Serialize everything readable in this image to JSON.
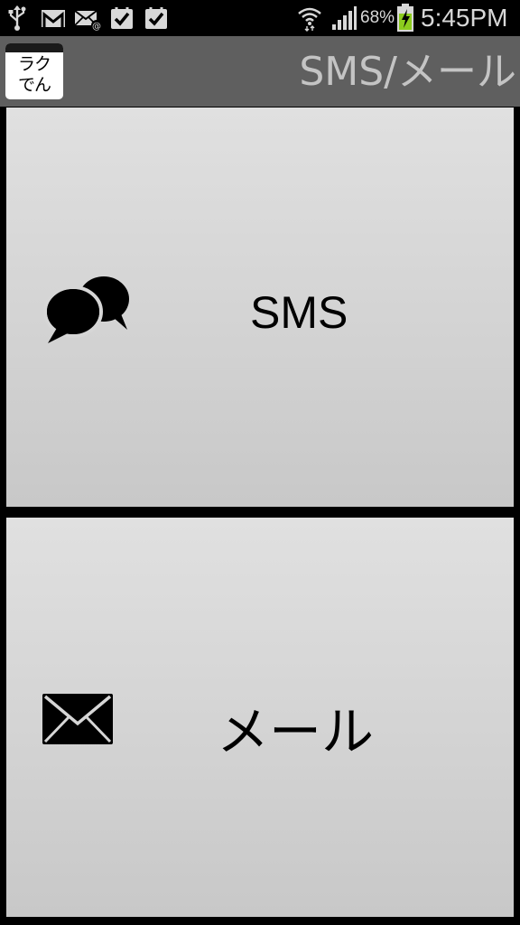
{
  "status_bar": {
    "battery": "68%",
    "time": "5:45PM",
    "icons": [
      "usb-icon",
      "gmail-icon",
      "email-notification-icon",
      "task-done-icon",
      "task-done-icon",
      "wifi-icon",
      "signal-icon",
      "battery-charging-icon"
    ]
  },
  "app": {
    "logo_line1": "ラク",
    "logo_line2": "でん",
    "title": "SMS/メール"
  },
  "tiles": {
    "sms": {
      "label": "SMS",
      "icon": "chat-bubbles-icon"
    },
    "mail": {
      "label": "メール",
      "icon": "envelope-icon"
    }
  },
  "colors": {
    "background": "#000000",
    "title_bar": "#5f5f5f",
    "title_text": "#c4c4c4",
    "tile": "#d6d6d6",
    "battery_charge": "#8ccc1e"
  }
}
